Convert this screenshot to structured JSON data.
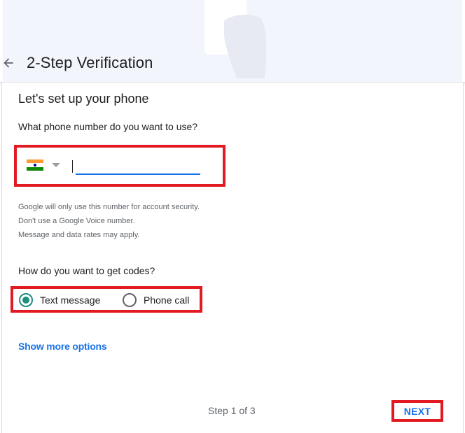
{
  "header": {
    "title": "2-Step Verification",
    "back_icon": "arrow-back-icon"
  },
  "main": {
    "heading": "Let's set up your phone",
    "phone_question": "What phone number do you want to use?",
    "phone": {
      "country_flag": "india-flag-icon",
      "dropdown_icon": "caret-down-icon",
      "value": "",
      "placeholder": ""
    },
    "notes": [
      "Google will only use this number for account security.",
      "Don't use a Google Voice number.",
      "Message and data rates may apply."
    ],
    "codes_question": "How do you want to get codes?",
    "options": [
      {
        "label": "Text message",
        "checked": true
      },
      {
        "label": "Phone call",
        "checked": false
      }
    ],
    "more_options_link": "Show more options"
  },
  "footer": {
    "step": "Step 1 of 3",
    "next_label": "NEXT"
  },
  "colors": {
    "accent": "#1a73e8",
    "radio_selected": "#1e8e7e",
    "highlight_box": "#e21b23"
  }
}
